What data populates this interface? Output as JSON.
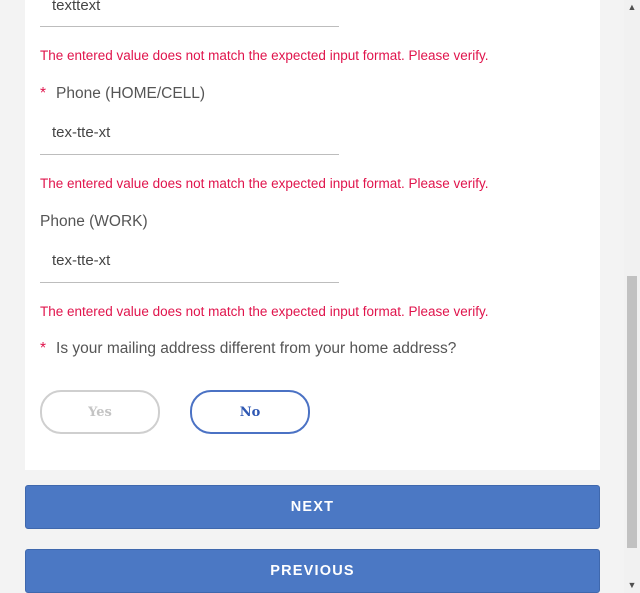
{
  "fields": {
    "name_value": "texttext",
    "phone_home": {
      "label": "Phone (HOME/CELL)",
      "value": "tex-tte-xt",
      "required_mark": "*"
    },
    "phone_work": {
      "label": "Phone (WORK)",
      "value": "tex-tte-xt"
    }
  },
  "errors": {
    "format_error_1": "The entered value does not match the expected input format. Please verify.",
    "format_error_2": "The entered value does not match the expected input format. Please verify.",
    "format_error_3": "The entered value does not match the expected input format. Please verify."
  },
  "question": {
    "required_mark": "*",
    "text": "Is your mailing address different from your home address?",
    "yes_label": "Yes",
    "no_label": "No"
  },
  "buttons": {
    "next_label": "NEXT",
    "previous_label": "PREVIOUS"
  },
  "scrollbar": {
    "up_arrow": "▲",
    "down_arrow": "▼"
  },
  "colors": {
    "error": "#e0144c",
    "primary": "#4b78c4",
    "selected_outline": "#4b72c4"
  }
}
